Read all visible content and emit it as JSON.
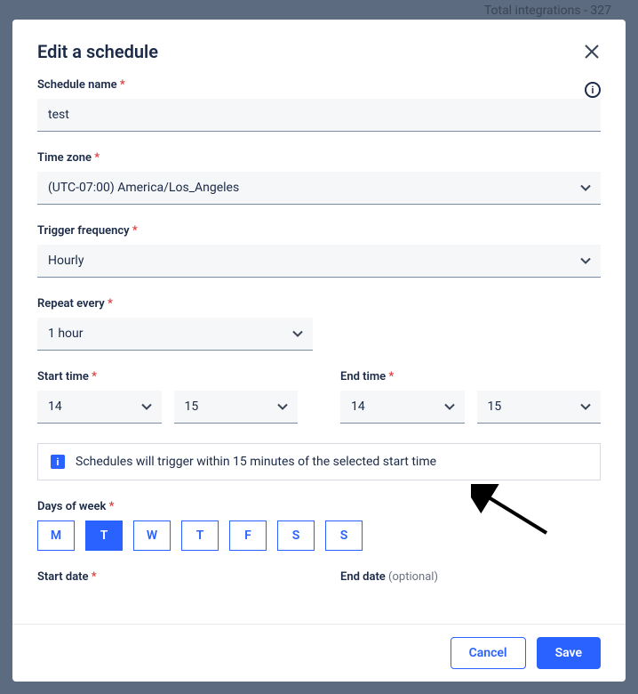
{
  "background_text": "Total integrations - 327",
  "modal": {
    "title": "Edit a schedule",
    "info_tooltip": "i",
    "fields": {
      "schedule_name": {
        "label": "Schedule name",
        "value": "test"
      },
      "timezone": {
        "label": "Time zone",
        "value": "(UTC-07:00) America/Los_Angeles"
      },
      "trigger_frequency": {
        "label": "Trigger frequency",
        "value": "Hourly"
      },
      "repeat_every": {
        "label": "Repeat every",
        "value": "1 hour"
      },
      "start_time": {
        "label": "Start time",
        "hour": "14",
        "minute": "15"
      },
      "end_time": {
        "label": "End time",
        "hour": "14",
        "minute": "15"
      },
      "info_banner": "Schedules will trigger within 15 minutes of the selected start time",
      "days_of_week": {
        "label": "Days of week",
        "days": [
          "M",
          "T",
          "W",
          "T",
          "F",
          "S",
          "S"
        ],
        "selected_index": 1
      },
      "start_date": {
        "label": "Start date"
      },
      "end_date": {
        "label": "End date",
        "optional": "(optional)"
      }
    },
    "footer": {
      "cancel": "Cancel",
      "save": "Save"
    }
  }
}
